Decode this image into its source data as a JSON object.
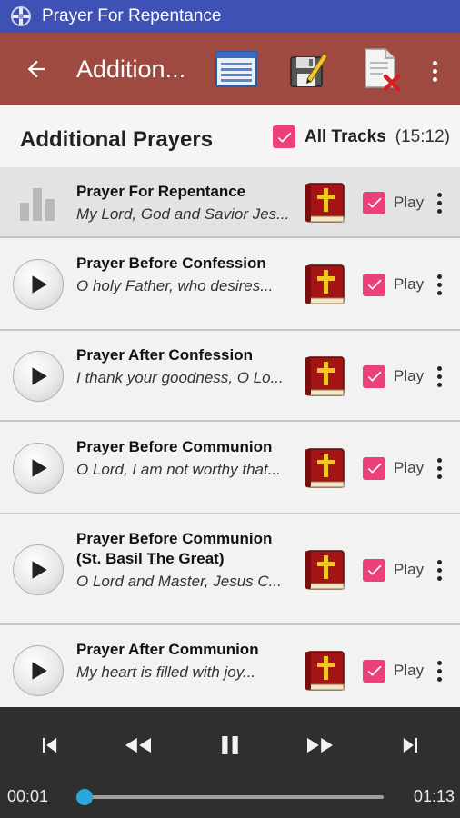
{
  "status_bar": {
    "app_title": "Prayer For Repentance"
  },
  "action_bar": {
    "title": "Addition...",
    "icons": [
      "back-arrow-icon",
      "list-view-icon",
      "save-edit-icon",
      "delete-document-icon",
      "overflow-menu-icon"
    ]
  },
  "header": {
    "title": "Additional Prayers",
    "all_tracks_label": "All Tracks",
    "all_tracks_duration": "(15:12)",
    "all_tracks_checked": true
  },
  "tracks": [
    {
      "title": "Prayer For Repentance",
      "subtitle": "My Lord, God and Savior Jes...",
      "play_label": "Play",
      "checked": true,
      "state": "playing"
    },
    {
      "title": "Prayer Before Confession",
      "subtitle": "O holy Father, who desires...",
      "play_label": "Play",
      "checked": true,
      "state": "idle"
    },
    {
      "title": "Prayer After Confession",
      "subtitle": "I thank your goodness, O Lo...",
      "play_label": "Play",
      "checked": true,
      "state": "idle"
    },
    {
      "title": "Prayer Before Communion",
      "subtitle": "O Lord, I am not worthy that...",
      "play_label": "Play",
      "checked": true,
      "state": "idle"
    },
    {
      "title": "Prayer Before Communion (St. Basil The Great)",
      "subtitle": "O Lord and Master, Jesus C...",
      "play_label": "Play",
      "checked": true,
      "state": "idle"
    },
    {
      "title": "Prayer After Communion",
      "subtitle": "My heart is filled with joy...",
      "play_label": "Play",
      "checked": true,
      "state": "idle"
    }
  ],
  "player": {
    "elapsed": "00:01",
    "total": "01:13",
    "progress": 0.014,
    "accent_color": "#29a8d8"
  },
  "colors": {
    "status_bar": "#3f51b5",
    "action_bar": "#9e4a40",
    "checkbox": "#ec407a",
    "player_bg": "#2f2f2f"
  }
}
